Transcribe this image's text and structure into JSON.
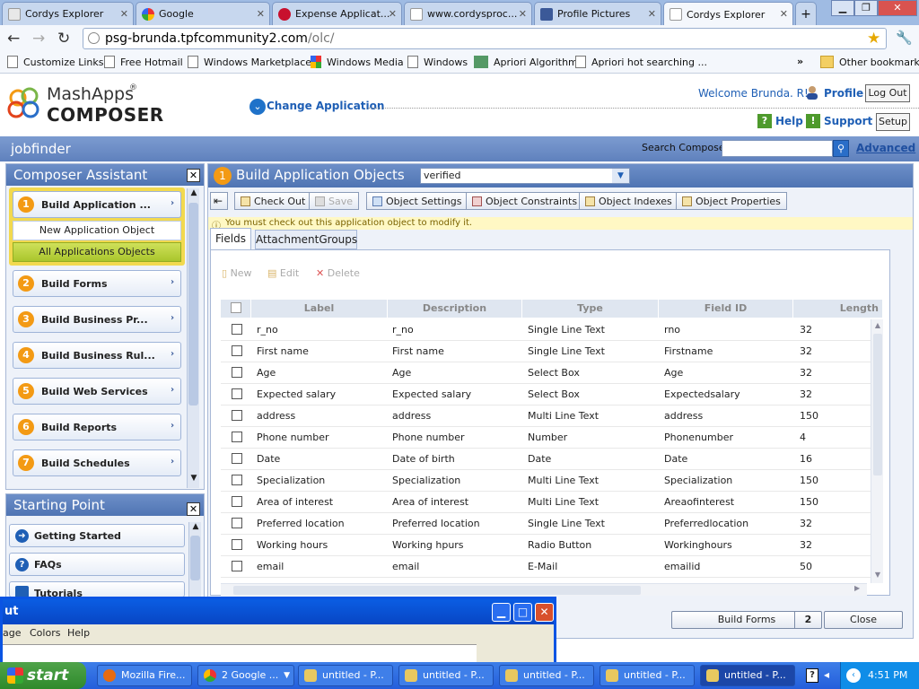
{
  "browser": {
    "tabs": [
      {
        "label": "Cordys Explorer"
      },
      {
        "label": "Google"
      },
      {
        "label": "Expense Applicat..."
      },
      {
        "label": "www.cordysproc..."
      },
      {
        "label": "Profile Pictures"
      },
      {
        "label": "Cordys Explorer"
      }
    ],
    "url_host": "psg-brunda.tpfcommunity2.com",
    "url_path": "/olc/",
    "bookmarks": [
      "Customize Links",
      "Free Hotmail",
      "Windows Marketplace",
      "Windows Media",
      "Windows",
      "Apriori Algorithm",
      "Apriori hot searching ..."
    ],
    "other_bookmarks": "Other bookmarks",
    "overflow": "»",
    "win_min": "▁",
    "win_max": "❐",
    "win_close": "✕"
  },
  "header": {
    "logo_top": "MashApps",
    "logo_reg": "®",
    "logo_bottom": "COMPOSER",
    "change_app": "Change Application",
    "welcome": "Welcome Brunda. R!",
    "profile": "Profile",
    "logout": "Log Out",
    "help": "Help",
    "support": "Support",
    "setup": "Setup"
  },
  "appbar": {
    "app_name": "jobfinder",
    "search_label": "Search Composer",
    "advanced": "Advanced"
  },
  "assistant": {
    "title": "Composer Assistant",
    "steps": [
      {
        "num": "1",
        "label": "Build Application ..."
      },
      {
        "num": "2",
        "label": "Build Forms"
      },
      {
        "num": "3",
        "label": "Build Business Pr..."
      },
      {
        "num": "4",
        "label": "Build Business Rul..."
      },
      {
        "num": "5",
        "label": "Build Web Services"
      },
      {
        "num": "6",
        "label": "Build Reports"
      },
      {
        "num": "7",
        "label": "Build Schedules"
      }
    ],
    "sub_new": "New Application Object",
    "sub_all": "All Applications Objects"
  },
  "starting_point": {
    "title": "Starting Point",
    "items": [
      "Getting Started",
      "FAQs",
      "Tutorials"
    ]
  },
  "main": {
    "step_num": "1",
    "title": "Build Application Objects",
    "object_select": "verified",
    "toolbar": {
      "check_out": "Check Out",
      "save": "Save",
      "object_settings": "Object Settings",
      "object_constraints": "Object Constraints",
      "object_indexes": "Object Indexes",
      "object_properties": "Object Properties"
    },
    "notice": "You must check out this application object to modify it.",
    "tabs": [
      "Fields",
      "AttachmentGroups"
    ],
    "grid_actions": {
      "new": "New",
      "edit": "Edit",
      "delete": "Delete"
    },
    "columns": [
      "Label",
      "Description",
      "Type",
      "Field ID",
      "Length"
    ],
    "rows": [
      [
        "r_no",
        "r_no",
        "Single Line Text",
        "rno",
        "32"
      ],
      [
        "First name",
        "First name",
        "Single Line Text",
        "Firstname",
        "32"
      ],
      [
        "Age",
        "Age",
        "Select Box",
        "Age",
        "32"
      ],
      [
        "Expected salary",
        "Expected salary",
        "Select Box",
        "Expectedsalary",
        "32"
      ],
      [
        "address",
        "address",
        "Multi Line Text",
        "address",
        "150"
      ],
      [
        "Phone number",
        "Phone number",
        "Number",
        "Phonenumber",
        "4"
      ],
      [
        "Date",
        "Date of birth",
        "Date",
        "Date",
        "16"
      ],
      [
        "Specialization",
        "Specialization",
        "Multi Line Text",
        "Specialization",
        "150"
      ],
      [
        "Area of interest",
        "Area of interest",
        "Multi Line Text",
        "Areaofinterest",
        "150"
      ],
      [
        "Preferred location",
        "Preferred location",
        "Single Line Text",
        "Preferredlocation",
        "32"
      ],
      [
        "Working hours",
        "Working hpurs",
        "Radio Button",
        "Workinghours",
        "32"
      ],
      [
        "email",
        "email",
        "E-Mail",
        "emailid",
        "50"
      ]
    ],
    "footer": {
      "build_forms": "Build Forms",
      "build_forms_num": "2",
      "close": "Close"
    }
  },
  "paint": {
    "title": "ut",
    "menu": [
      "age",
      "Colors",
      "Help"
    ]
  },
  "taskbar": {
    "start": "start",
    "tasks": [
      "Mozilla Fire...",
      "2 Google ...",
      "untitled - P...",
      "untitled - P...",
      "untitled - P...",
      "untitled - P...",
      "untitled - P..."
    ],
    "clock": "4:51 PM"
  }
}
